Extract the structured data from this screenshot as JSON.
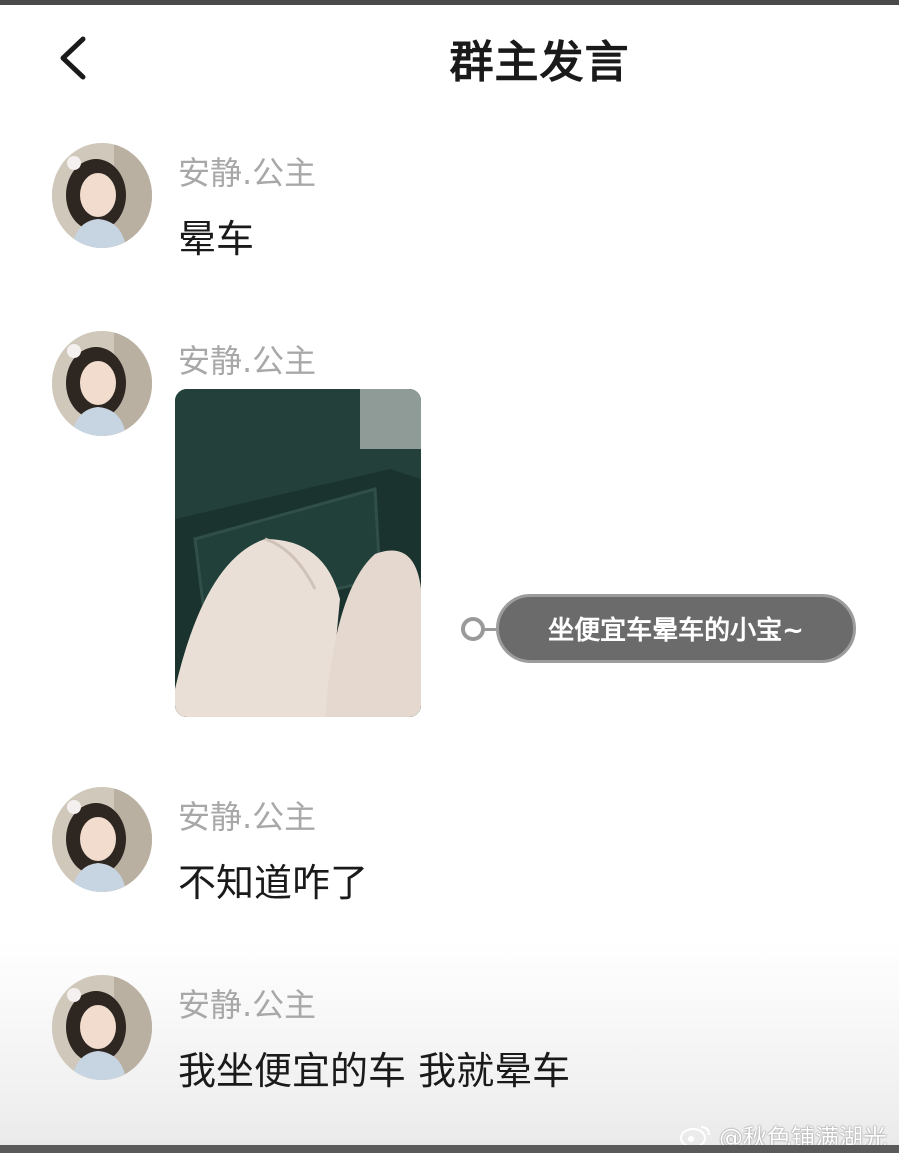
{
  "header": {
    "title": "群主发言",
    "back_icon": "chevron-left-icon"
  },
  "messages": [
    {
      "username": "安静.公主",
      "text": "晕车"
    },
    {
      "username": "安静.公主",
      "image": "photo-in-car"
    },
    {
      "username": "安静.公主",
      "text": "不知道咋了"
    },
    {
      "username": "安静.公主",
      "text": "我坐便宜的车 我就晕车"
    }
  ],
  "annotation": {
    "text": "坐便宜车晕车的小宝~"
  },
  "watermark": {
    "text": "@秋色铺满湖光",
    "icon": "weibo-icon"
  },
  "colors": {
    "username": "#a8a8a8",
    "message": "#1a1a1a",
    "annotation_bg": "#6b6b6b"
  }
}
